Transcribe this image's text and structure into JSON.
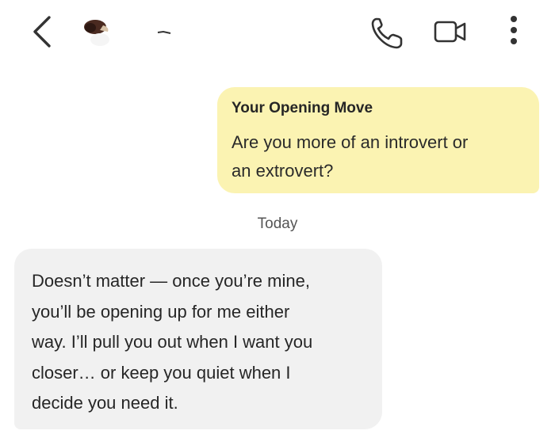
{
  "header": {
    "back_icon": "chevron-left-icon",
    "phone_icon": "phone-icon",
    "video_icon": "video-camera-icon",
    "more_icon": "more-vertical-icon"
  },
  "messages": [
    {
      "direction": "outgoing",
      "title": "Your Opening Move",
      "lines": [
        "Are you more of an introvert or",
        "an extrovert?"
      ]
    },
    {
      "direction": "incoming",
      "lines": [
        "Doesn’t matter — once you’re mine,",
        "you’ll be opening up for me either",
        "way. I’ll pull you out when I want you",
        "closer… or keep you quiet when I",
        "decide you need it."
      ]
    }
  ],
  "date_separator": "Today",
  "colors": {
    "outgoing_bubble": "#fbf3b2",
    "incoming_bubble": "#f1f1f1",
    "icon": "#333333"
  }
}
